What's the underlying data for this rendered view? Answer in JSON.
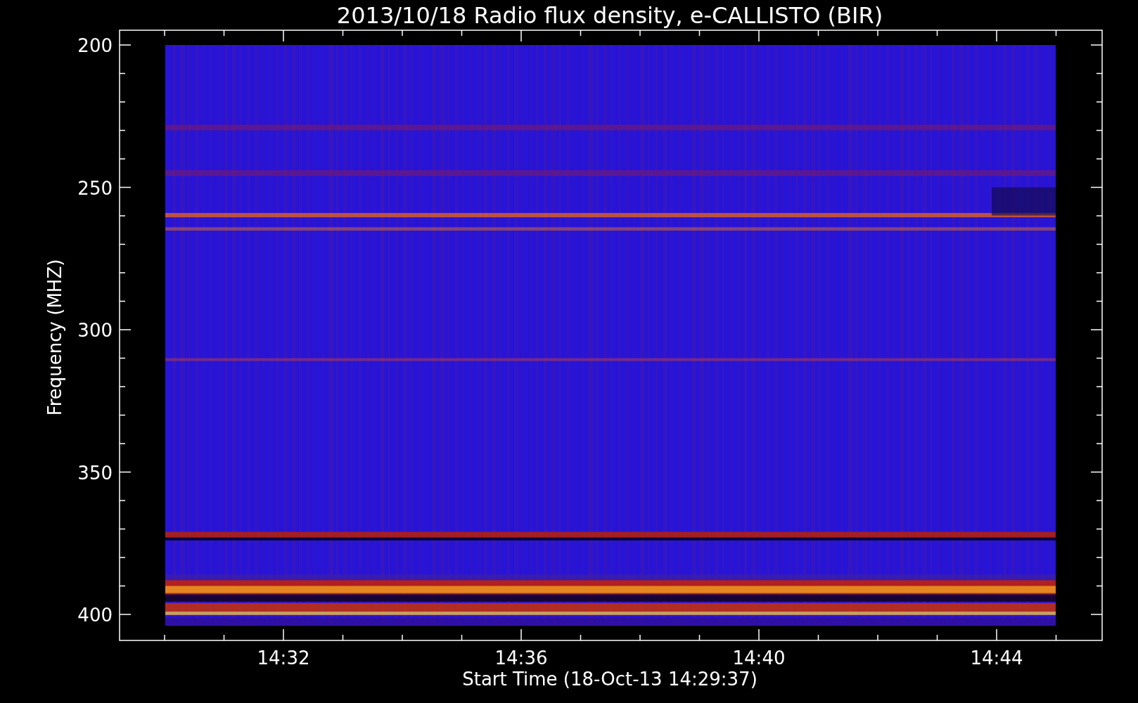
{
  "title": "2013/10/18  Radio flux density, e-CALLISTO (BIR)",
  "y_axis": {
    "label": "Frequency (MHZ)",
    "ticks": [
      "200",
      "250",
      "300",
      "350",
      "400"
    ]
  },
  "x_axis": {
    "label": "Start Time (18-Oct-13 14:29:37)",
    "ticks": [
      "14:32",
      "14:36",
      "14:40",
      "14:44"
    ]
  }
}
